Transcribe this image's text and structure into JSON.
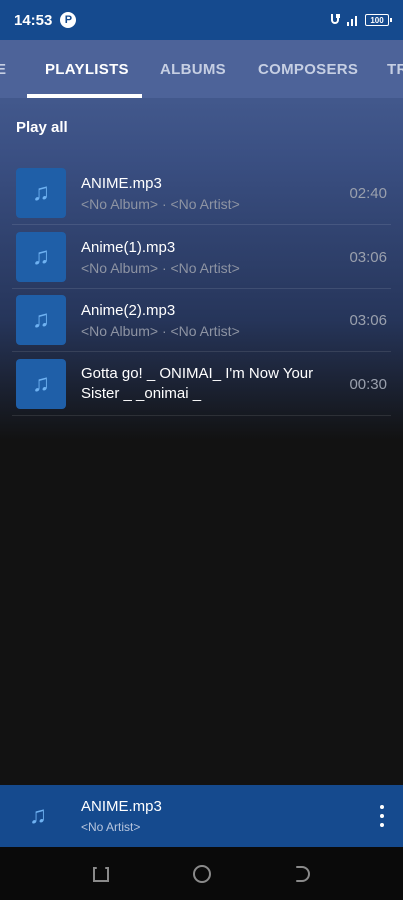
{
  "status_bar": {
    "time": "14:53",
    "app_badge": "P",
    "battery": "100"
  },
  "tabs": [
    {
      "label": "E",
      "active": false
    },
    {
      "label": "PLAYLISTS",
      "active": true
    },
    {
      "label": "ALBUMS",
      "active": false
    },
    {
      "label": "COMPOSERS",
      "active": false
    },
    {
      "label": "TR",
      "active": false
    }
  ],
  "play_all_label": "Play all",
  "tracks": [
    {
      "title": "ANIME.mp3",
      "subtitle": "<No Album> · <No Artist>",
      "duration": "02:40"
    },
    {
      "title": "Anime(1).mp3",
      "subtitle": "<No Album> · <No Artist>",
      "duration": "03:06"
    },
    {
      "title": "Anime(2).mp3",
      "subtitle": "<No Album> · <No Artist>",
      "duration": "03:06"
    },
    {
      "title": "Gotta go! _ ONIMAI_ I'm Now Your Sister _ _onimai _",
      "subtitle": "",
      "duration": "00:30"
    }
  ],
  "mini_player": {
    "title": "ANIME.mp3",
    "subtitle": "<No Artist>"
  },
  "icons": {
    "track_thumb": "music-note-icon",
    "more": "more-vert-icon",
    "nav_recents": "recents-icon",
    "nav_home": "home-icon",
    "nav_back": "back-icon"
  },
  "colors": {
    "accent": "#154a8e",
    "thumb_bg": "#1f5fa8",
    "note": "#6fb2f2"
  }
}
